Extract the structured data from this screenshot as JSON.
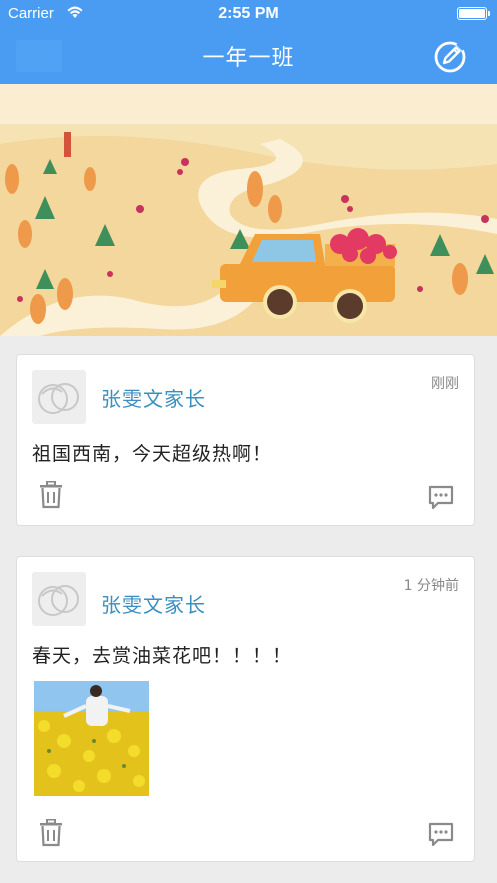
{
  "status_bar": {
    "carrier": "Carrier",
    "time": "2:55 PM",
    "wifi_icon": "wifi-icon",
    "battery_icon": "battery-icon"
  },
  "nav": {
    "title": "一年一班",
    "compose_icon": "compose-icon",
    "color": "#4a9cf2"
  },
  "banner": {
    "image": "illustrated-landscape-truck-with-flowers"
  },
  "posts": [
    {
      "author": "张雯文家长",
      "time": "刚刚",
      "content": "祖国西南，今天超级热啊！",
      "has_photo": false
    },
    {
      "author": "张雯文家长",
      "time": "1 分钟前",
      "content": "春天，去赏油菜花吧！！！！",
      "has_photo": true,
      "photo": "person-in-rapeseed-flower-field"
    }
  ],
  "colors": {
    "accent": "#4a9cf2",
    "author_text": "#3a8fc0",
    "background": "#ececec"
  }
}
